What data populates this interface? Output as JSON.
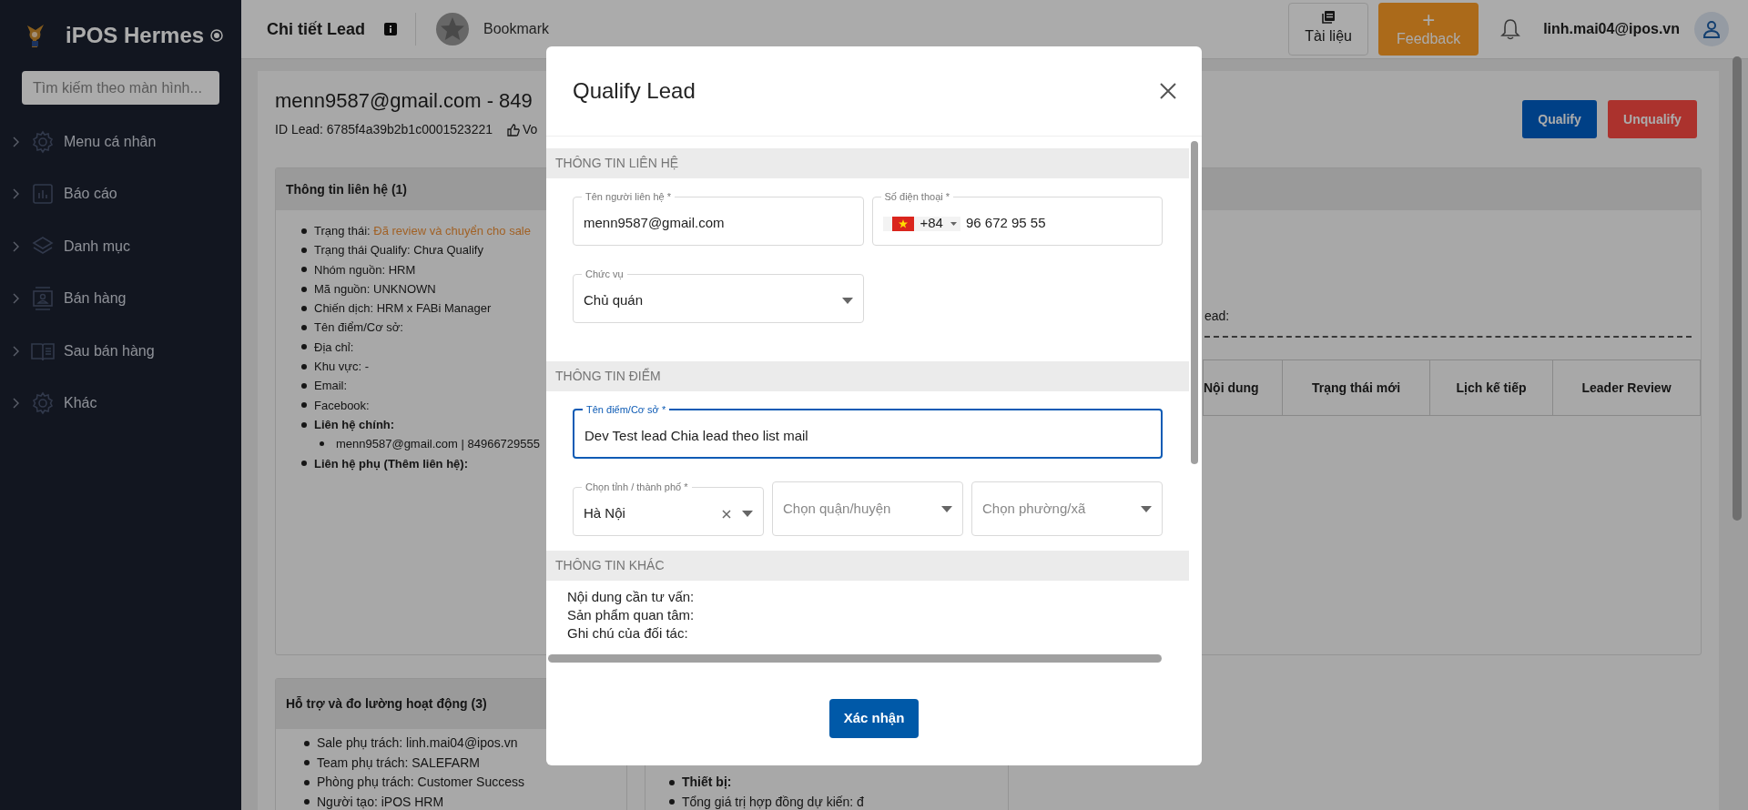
{
  "sidebar": {
    "brand": "iPOS Hermes",
    "search": {
      "placeholder": "Tìm kiếm theo màn hình..."
    },
    "items": [
      {
        "label": "Menu cá nhân"
      },
      {
        "label": "Báo cáo"
      },
      {
        "label": "Danh mục"
      },
      {
        "label": "Bán hàng"
      },
      {
        "label": "Sau bán hàng"
      },
      {
        "label": "Khác"
      }
    ]
  },
  "topbar": {
    "title": "Chi tiết Lead",
    "bookmark": "Bookmark",
    "docs": "Tài liệu",
    "feedback_icon": "+",
    "feedback": "Feedback",
    "user": "linh.mai04@ipos.vn"
  },
  "lead": {
    "title": "menn9587@gmail.com - 849",
    "id": "ID Lead: 6785f4a39b2b1c0001523221",
    "vote": "Vo",
    "actions": [
      {
        "label": "Qualify",
        "kind": "primary"
      },
      {
        "label": "Unqualify",
        "kind": "danger"
      }
    ]
  },
  "contact_card": {
    "title": "Thông tin liên hệ (1)",
    "items": [
      {
        "kind": "status",
        "label": "Trạng thái:",
        "value": "Đã review và chuyển cho sale"
      },
      {
        "kind": "text",
        "text": "Trạng thái Qualify: Chưa Qualify"
      },
      {
        "kind": "text",
        "text": "Nhóm nguồn: HRM"
      },
      {
        "kind": "text",
        "text": "Mã nguồn: UNKNOWN"
      },
      {
        "kind": "text",
        "text": "Chiến dịch: HRM x FABi Manager"
      },
      {
        "kind": "text",
        "text": "Tên điểm/Cơ sở:"
      },
      {
        "kind": "text",
        "text": "Địa chỉ:"
      },
      {
        "kind": "text",
        "text": "Khu vực: -"
      },
      {
        "kind": "text",
        "text": "Email:"
      },
      {
        "kind": "text",
        "text": "Facebook:"
      },
      {
        "kind": "heading",
        "text": "Liên hệ chính:",
        "children": [
          {
            "kind": "text",
            "text": "menn9587@gmail.com | 84966729555"
          }
        ]
      },
      {
        "kind": "heading",
        "text": "Liên hệ phụ (Thêm liên hệ):"
      }
    ]
  },
  "history_card": {
    "text": "ead:",
    "columns": [
      "Nội dung",
      "Trạng thái mới",
      "Lịch kế tiếp",
      "Leader Review"
    ]
  },
  "support_card": {
    "title": "Hỗ trợ và đo lường hoạt động (3)",
    "items": [
      {
        "kind": "text",
        "text": "Sale phụ trách: linh.mai04@ipos.vn"
      },
      {
        "kind": "text",
        "text": "Team phụ trách: SALEFARM"
      },
      {
        "kind": "text",
        "text": "Phòng phụ trách: Customer Success"
      },
      {
        "kind": "text",
        "text": "Người tạo: iPOS HRM"
      }
    ]
  },
  "product_card": {
    "items": [
      {
        "kind": "heading",
        "text": "Thiết bị:"
      },
      {
        "kind": "text",
        "text": "Tổng giá trị hợp đồng dự kiến: đ"
      }
    ]
  },
  "dialog": {
    "title": "Qualify Lead",
    "sections": [
      {
        "title": "THÔNG TIN LIÊN HỆ",
        "rows": [
          [
            {
              "kind": "text",
              "label": "Tên người liên hệ *",
              "value": "menn9587@gmail.com",
              "focused": false
            },
            {
              "kind": "phone",
              "label": "Số điện thoại *",
              "code": "+84",
              "value": "96 672 95 55"
            }
          ],
          [
            {
              "kind": "select",
              "label": "Chức vụ",
              "value": "Chủ quán"
            }
          ]
        ]
      },
      {
        "title": "THÔNG TIN ĐIỂM",
        "rows": [
          [
            {
              "kind": "text",
              "label": "Tên điểm/Cơ sở *",
              "value": "Dev Test lead Chia lead theo list mail",
              "focused": true
            }
          ],
          [
            {
              "kind": "select",
              "label": "Chọn tỉnh / thành phố *",
              "value": "Hà Nội",
              "clearable": true
            },
            {
              "kind": "select",
              "placeholder": "Chọn quận/huyện"
            },
            {
              "kind": "select",
              "placeholder": "Chọn phường/xã"
            }
          ]
        ]
      },
      {
        "title": "THÔNG TIN KHÁC",
        "lines": [
          "Nội dung cần tư vấn:",
          "Sản phẩm quan tâm:",
          "Ghi chú của đối tác:"
        ]
      }
    ],
    "confirm": "Xác nhận"
  }
}
